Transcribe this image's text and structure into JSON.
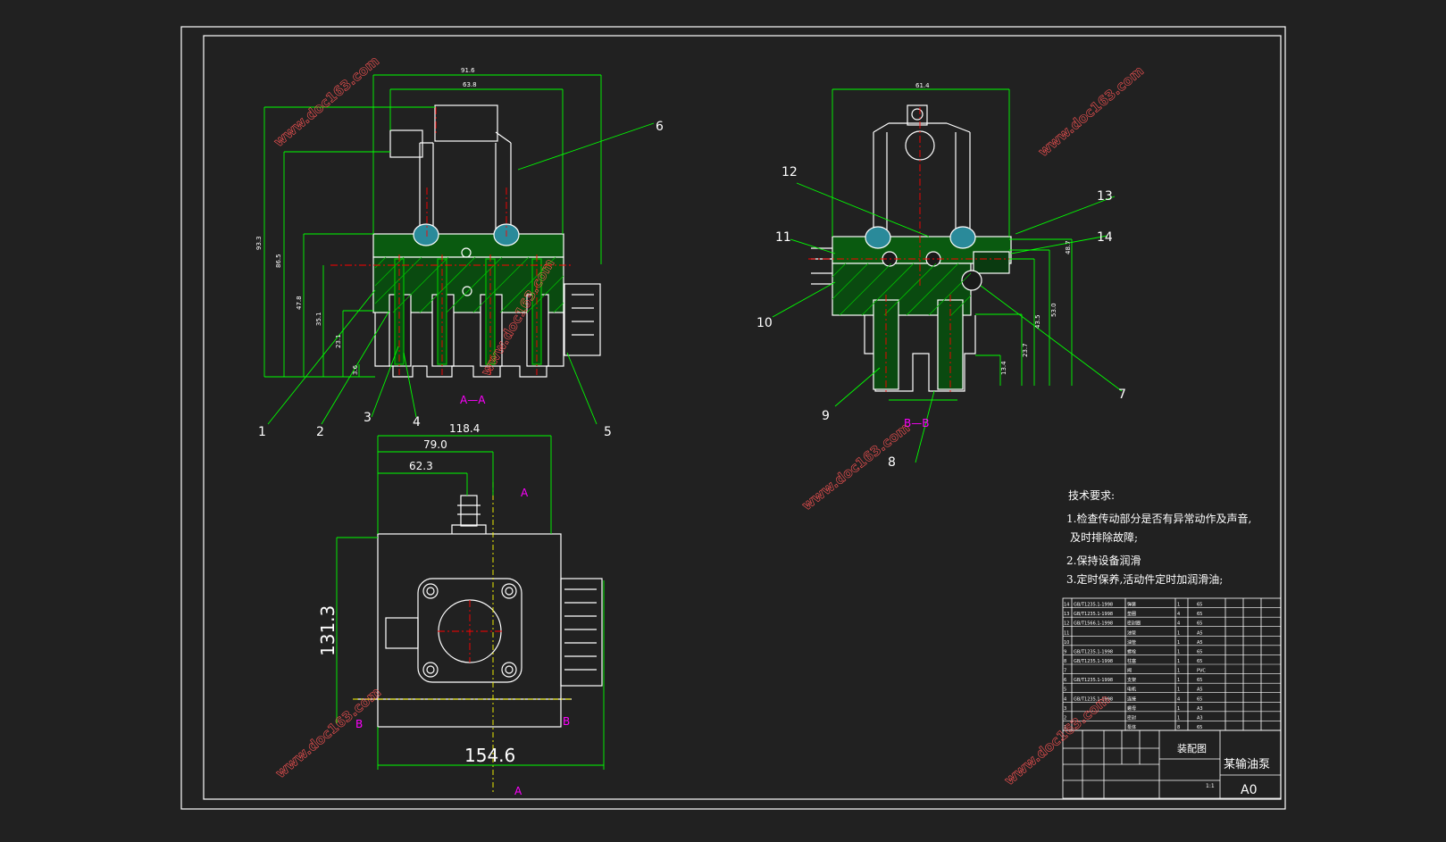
{
  "colors": {
    "background": "#212121",
    "frame": "#ffffff",
    "part": "#ffffff",
    "dimension": "#00ff00",
    "centerline": "#ff0000",
    "section_label": "#ff00ff",
    "hatch": "#00c000",
    "fill_blue": "#2a8a9a",
    "watermark": "#ff4444"
  },
  "watermark": "www.doc163.com",
  "views": {
    "aa": {
      "label": "A—A",
      "dims": {
        "top1": "91.6",
        "top2": "63.8",
        "left1": "93.3",
        "left2": "86.5",
        "left3": "47.8",
        "left4": "35.1",
        "left5": "23.1",
        "left6": "3.6"
      },
      "callouts": [
        "1",
        "2",
        "3",
        "4",
        "5",
        "6"
      ]
    },
    "bb": {
      "label": "B—B",
      "dims": {
        "top": "61.4",
        "right1": "48.7",
        "right2": "53.0",
        "right3": "43.5",
        "right4": "23.7",
        "right5": "13.4"
      },
      "callouts": [
        "7",
        "8",
        "9",
        "10",
        "11",
        "12",
        "13",
        "14"
      ]
    },
    "top": {
      "dims": {
        "w1": "118.4",
        "w2": "79.0",
        "w3": "62.3",
        "h": "131.3",
        "w_bottom": "154.6"
      },
      "cut_a": "A",
      "cut_b": "B"
    }
  },
  "notes": {
    "title": "技术要求:",
    "items": [
      "1.检查传动部分是否有异常动作及声音,",
      "及时排除故障;",
      "2.保持设备润滑",
      "3.定时保养,活动件定时加润滑油;"
    ]
  },
  "title_block": {
    "drawing_name": "装配图",
    "product": "某输油泵",
    "size": "A0",
    "scale": "1:1",
    "bom": [
      [
        "14",
        "GB/T1235.1-1998",
        "弹簧",
        "1",
        "65"
      ],
      [
        "13",
        "GB/T1235.1-1998",
        "垫圈",
        "4",
        "65"
      ],
      [
        "12",
        "GB/T1566.1-1998",
        "密封圈",
        "4",
        "65"
      ],
      [
        "11",
        "",
        "油管",
        "1",
        "A5"
      ],
      [
        "10",
        "",
        "油管",
        "1",
        "A5"
      ],
      [
        "9",
        "GB/T1235.1-1998",
        "螺栓",
        "1",
        "65"
      ],
      [
        "8",
        "GB/T1235.1-1998",
        "柱塞",
        "1",
        "65"
      ],
      [
        "7",
        "",
        "阀",
        "1",
        "PVC"
      ],
      [
        "6",
        "GB/T1235.1-1998",
        "支架",
        "1",
        "65"
      ],
      [
        "5",
        "",
        "电机",
        "1",
        "A5"
      ],
      [
        "4",
        "GB/T1235.1-1998",
        "连接",
        "4",
        "65"
      ],
      [
        "3",
        "",
        "螺母",
        "1",
        "A3"
      ],
      [
        "2",
        "",
        "密封",
        "1",
        "A3"
      ],
      [
        "1",
        "",
        "泵体",
        "8",
        "65"
      ]
    ]
  }
}
